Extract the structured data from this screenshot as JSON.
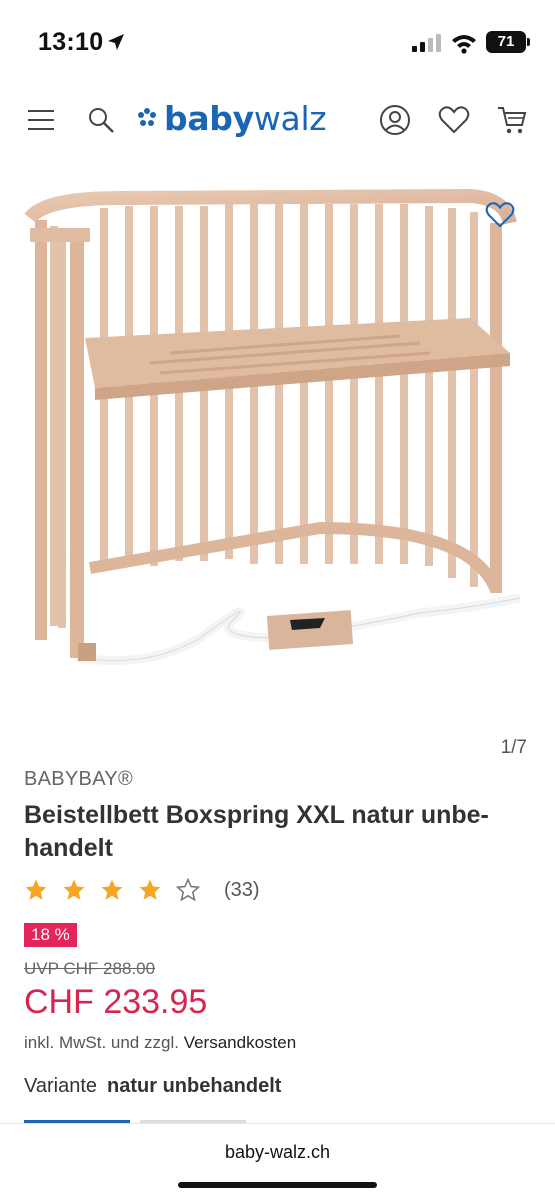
{
  "status": {
    "time": "13:10",
    "battery": "71"
  },
  "header": {
    "logo_part1": "baby",
    "logo_part2": "walz",
    "icons": [
      "menu-icon",
      "search-icon",
      "account-icon",
      "wishlist-icon",
      "cart-icon"
    ]
  },
  "gallery": {
    "counter": "1/7"
  },
  "product": {
    "brand": "BABYBAY®",
    "title": "Beistellbett Boxspring XXL natur unbe-handelt",
    "rating": 4,
    "rating_max": 5,
    "review_count": "(33)",
    "discount": "18 %",
    "uvp": "UVP CHF 288.00",
    "price": "CHF 233.95",
    "tax_text": "inkl. MwSt. und zzgl.",
    "shipping_link": "Versandkosten",
    "variant_label": "Variante",
    "variant_value": "natur unbehandelt"
  },
  "browser": {
    "url": "baby-walz.ch"
  },
  "colors": {
    "brand_blue": "#1a66b3",
    "price_red": "#d6264f",
    "discount_bg": "#e4245b",
    "star": "#f5a623"
  }
}
